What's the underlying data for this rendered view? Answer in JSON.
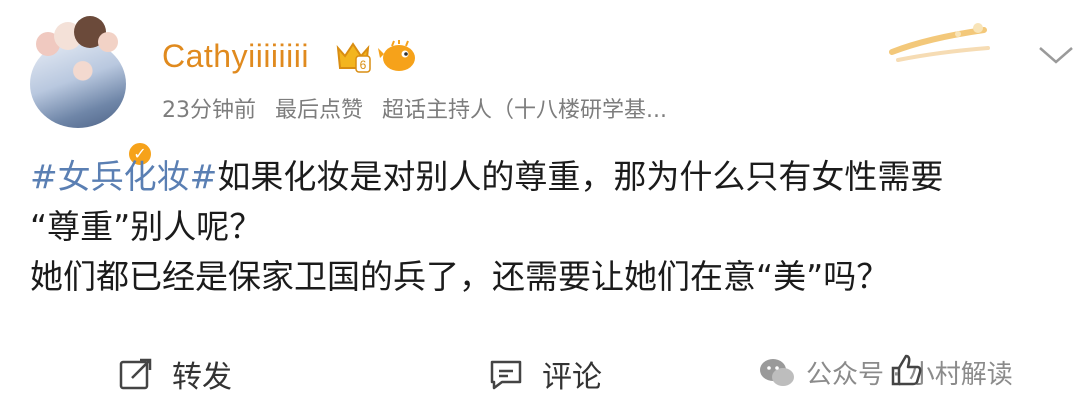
{
  "post": {
    "username": "Cathyiiiiiiii",
    "level_badge": "6",
    "meta": {
      "time": "23分钟前",
      "likes_status": "最后点赞",
      "role": "超话主持人（十八楼研学基..."
    },
    "content": {
      "hashtag": "#女兵化妆#",
      "line1_rest": "如果化妆是对别人的尊重，那为什么只有女性需要",
      "line2": "“尊重”别人呢？",
      "line3": "她们都已经是保家卫国的兵了，还需要让她们在意“美”吗？"
    },
    "actions": {
      "repost_label": "转发",
      "comment_label": "评论"
    }
  },
  "watermark": {
    "text": "公众号 · 小村解读"
  },
  "colors": {
    "username": "#e08a1e",
    "hashtag": "#5a7fb3",
    "meta": "#7d7d7d",
    "verified_badge": "#f6a21a"
  },
  "icons": [
    "avatar-image",
    "verified-icon",
    "crown-level-icon",
    "pufferfish-icon",
    "header-decoration",
    "chevron-down-icon",
    "repost-icon",
    "comment-icon",
    "wechat-icon",
    "like-thumb-icon"
  ]
}
